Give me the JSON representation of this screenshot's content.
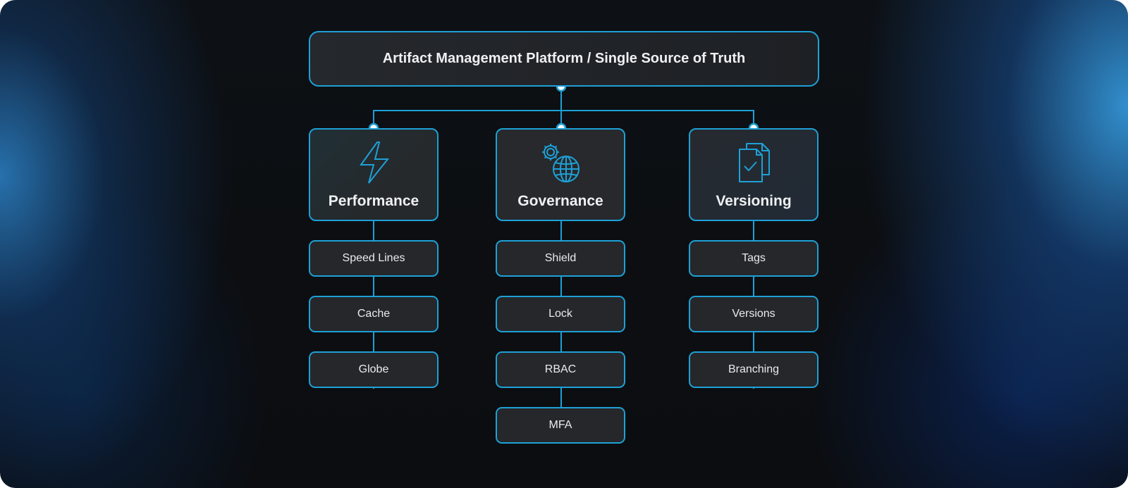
{
  "root": {
    "label": "Artifact Management Platform / Single Source of Truth"
  },
  "categories": [
    {
      "label": "Performance",
      "icon": "lightning-bolt-icon",
      "items": [
        "Speed Lines",
        "Cache",
        "Globe"
      ]
    },
    {
      "label": "Governance",
      "icon": "gear-globe-icon",
      "items": [
        "Shield",
        "Lock",
        "RBAC",
        "MFA"
      ]
    },
    {
      "label": "Versioning",
      "icon": "documents-check-icon",
      "items": [
        "Tags",
        "Versions",
        "Branching"
      ]
    }
  ],
  "colors": {
    "accent": "#1ea0d6",
    "box_fill": "#25272b",
    "background": "#0b0d10"
  }
}
